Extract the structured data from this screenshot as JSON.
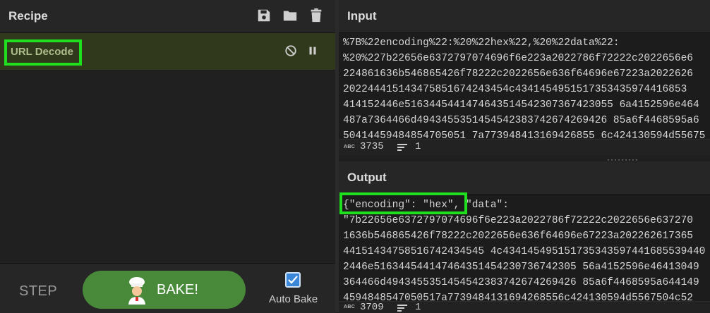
{
  "recipe": {
    "title": "Recipe",
    "operations": [
      {
        "name": "URL Decode",
        "disabled": false,
        "paused": false
      }
    ]
  },
  "controls": {
    "step_label": "STEP",
    "bake_label": "BAKE!",
    "auto_bake_label": "Auto Bake",
    "auto_bake_checked": true
  },
  "input": {
    "title": "Input",
    "lines": [
      "%7B%22encoding%22:%20%22hex%22,%20%22data%22:",
      "%20%227b22656e6372797074696f6e223a2022786f72222c2022656e6",
      "224861636b546865426f78222c2022656e636f64696e67223a2022626",
      "202244415143475851674243454c4341454951517353435974416853",
      "414152446e5163445441474643514542307367423055 6a4152596e464",
      "487a7364466d4943455351454542383742674269426 85a6f4468595a6",
      "50414459484854705051 7a773948413169426855 6c424130594d55675"
    ],
    "char_count": "3735",
    "line_count": "1"
  },
  "output": {
    "title": "Output",
    "first_line_highlight": "{\"encoding\": \"hex\",",
    "first_line_rest": " \"data\":",
    "lines": [
      "\"7b22656e6372797074696f6e223a2022786f72222c2022656e637270",
      "1636b546865426f78222c2022656e636f64696e67223a202262617365",
      "44151434758516742434545 4c434145495151735343597441685539440",
      "2446e516344544147464351454230736742305 56a4152596e46413049",
      "364466d4943455351454542383742674269426 85a6f4468595a644149",
      "4594848547050517a7739484131694268556c424130594d5567504c52"
    ],
    "char_count": "3709",
    "line_count": "1"
  },
  "icons": {
    "save": "save-icon",
    "load": "folder-icon",
    "clear": "trash-icon",
    "disable": "disable-icon",
    "pause": "pause-icon",
    "chef": "chef-icon"
  },
  "colors": {
    "highlight": "#1fe01f",
    "bake_button": "#498a3a",
    "operation_bg": "#31391c",
    "operation_text": "#aebc8c"
  }
}
